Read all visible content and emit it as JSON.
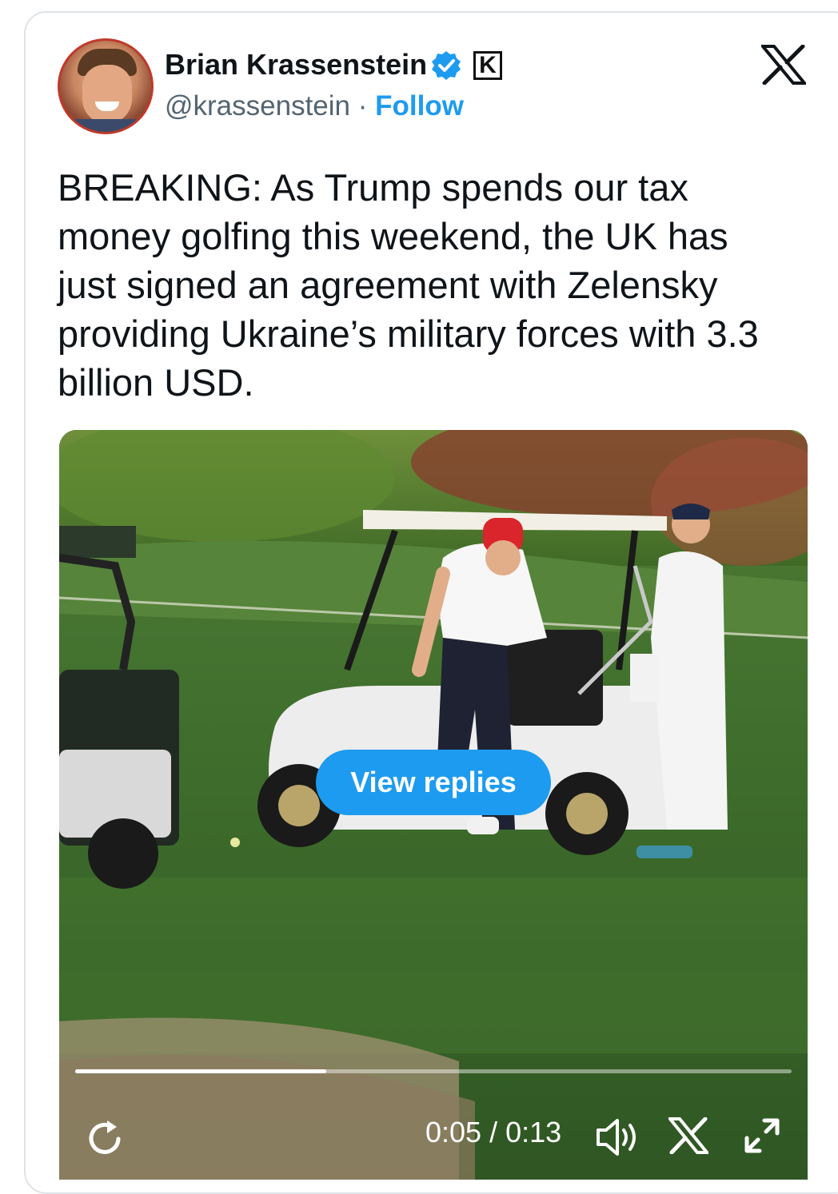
{
  "author": {
    "name": "Brian Krassenstein",
    "handle": "@krassenstein",
    "separator": " · ",
    "follow_label": "Follow",
    "affiliate_badge": "K"
  },
  "icons": {
    "avatar": "profile-photo",
    "verified": "verified-check-icon",
    "platform": "x-logo-icon",
    "replay": "replay-icon",
    "volume": "volume-icon",
    "x_watermark": "x-logo-icon",
    "fullscreen": "expand-icon"
  },
  "tweet": {
    "text": "BREAKING:  As Trump spends our tax money golfing this weekend, the UK has just signed an agreement with Zelensky providing Ukraine’s military forces with 3.3 billion USD."
  },
  "video": {
    "view_replies_label": "View replies",
    "time": "0:05 / 0:13",
    "progress": 0.35
  },
  "colors": {
    "accent": "#1d9bf0",
    "text": "#0f1419",
    "secondary": "#536471"
  }
}
